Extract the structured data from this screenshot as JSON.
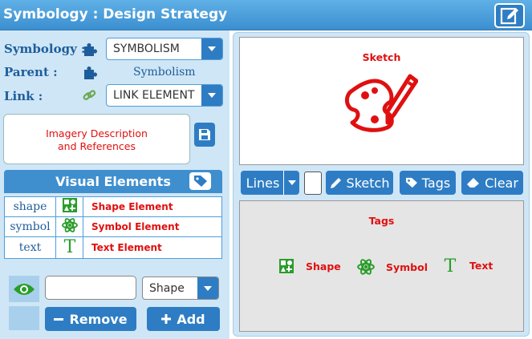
{
  "window": {
    "title": "Symbology : Design Strategy"
  },
  "form": {
    "symbology_label": "Symbology :",
    "symbology_value": "SYMBOLISM",
    "parent_label": "Parent :",
    "parent_value": "Symbolism",
    "link_label": "Link :",
    "link_value": "LINK ELEMENT",
    "description": "Imagery Description\nand References"
  },
  "visual_elements": {
    "title": "Visual Elements",
    "rows": [
      {
        "name": "shape",
        "icon": "shape-icon",
        "label": "Shape Element"
      },
      {
        "name": "symbol",
        "icon": "atom-icon",
        "label": "Symbol Element"
      },
      {
        "name": "text",
        "icon": "text-t-icon",
        "label": "Text Element"
      }
    ]
  },
  "editor": {
    "name_value": "",
    "type_value": "Shape",
    "remove_label": "Remove",
    "add_label": "Add"
  },
  "sketch": {
    "title": "Sketch"
  },
  "toolbar": {
    "lines_label": "Lines",
    "sketch_label": "Sketch",
    "tags_label": "Tags",
    "clear_label": "Clear"
  },
  "tags": {
    "title": "Tags",
    "items": [
      {
        "label": "Shape",
        "icon": "shape-icon"
      },
      {
        "label": "Symbol",
        "icon": "atom-icon"
      },
      {
        "label": "Text",
        "icon": "text-t-icon"
      }
    ]
  },
  "colors": {
    "accent": "#2e7dc4",
    "header": "#3f8fcf",
    "label": "#1e5d9c",
    "red": "#e01010",
    "green": "#2a9d2a",
    "pane": "#cfe6f6"
  }
}
